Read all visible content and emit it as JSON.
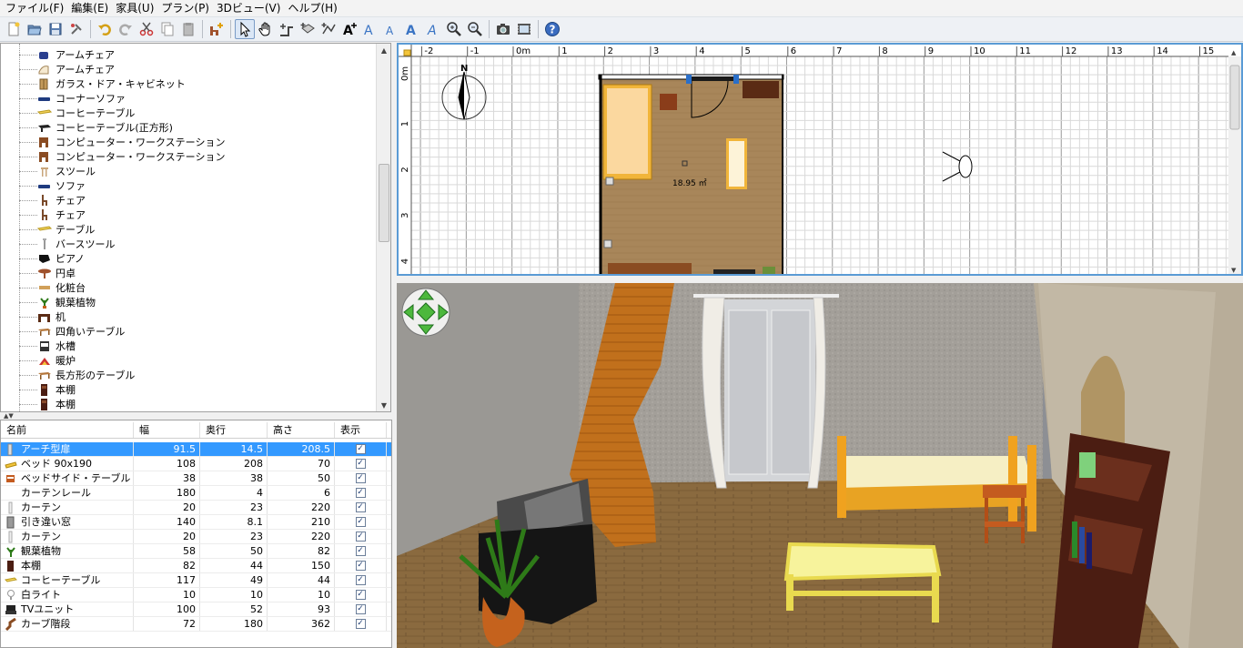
{
  "menubar": {
    "items": [
      "ファイル(F)",
      "編集(E)",
      "家具(U)",
      "プラン(P)",
      "3Dビュー(V)",
      "ヘルプ(H)"
    ]
  },
  "toolbar": {
    "buttons": [
      "new-file-icon",
      "open-file-icon",
      "save-file-icon",
      "cut-icon",
      "sep",
      "undo-icon",
      "redo-icon",
      "scissors-icon",
      "copy-icon",
      "paste-icon",
      "sep",
      "add-furniture-icon",
      "sep",
      "select-arrow-icon",
      "pan-hand-icon",
      "create-walls-icon",
      "create-rooms-icon",
      "create-dimensions-icon",
      "add-text-icon",
      "text-style-a-icon",
      "text-style-b-icon",
      "text-bold-icon",
      "text-italic-icon",
      "zoom-in-icon",
      "zoom-out-icon",
      "sep",
      "create-photo-icon",
      "create-video-icon",
      "sep",
      "help-icon"
    ]
  },
  "catalog": {
    "items": [
      {
        "label": "アームチェア",
        "icon": "armchair-blue"
      },
      {
        "label": "アームチェア",
        "icon": "armchair-white"
      },
      {
        "label": "ガラス・ドア・キャビネット",
        "icon": "cabinet"
      },
      {
        "label": "コーナーソファ",
        "icon": "sofa-blue"
      },
      {
        "label": "コーヒーテーブル",
        "icon": "table-yellow"
      },
      {
        "label": "コーヒーテーブル(正方形)",
        "icon": "table-black"
      },
      {
        "label": "コンピューター・ワークステーション",
        "icon": "workstation"
      },
      {
        "label": "コンピューター・ワークステーション",
        "icon": "workstation"
      },
      {
        "label": "スツール",
        "icon": "stool"
      },
      {
        "label": "ソファ",
        "icon": "sofa-blue"
      },
      {
        "label": "チェア",
        "icon": "chair"
      },
      {
        "label": "チェア",
        "icon": "chair"
      },
      {
        "label": "テーブル",
        "icon": "table-yellow"
      },
      {
        "label": "バースツール",
        "icon": "barstool"
      },
      {
        "label": "ピアノ",
        "icon": "piano"
      },
      {
        "label": "円卓",
        "icon": "round-table"
      },
      {
        "label": "化粧台",
        "icon": "dresser"
      },
      {
        "label": "観葉植物",
        "icon": "plant"
      },
      {
        "label": "机",
        "icon": "desk"
      },
      {
        "label": "四角いテーブル",
        "icon": "table-brown"
      },
      {
        "label": "水槽",
        "icon": "aquarium"
      },
      {
        "label": "暖炉",
        "icon": "fireplace"
      },
      {
        "label": "長方形のテーブル",
        "icon": "table-brown"
      },
      {
        "label": "本棚",
        "icon": "bookshelf"
      },
      {
        "label": "本棚",
        "icon": "bookshelf"
      }
    ]
  },
  "furniture_table": {
    "headers": [
      "名前",
      "幅",
      "奥行",
      "高さ",
      "表示"
    ],
    "rows": [
      {
        "name": "アーチ型扉",
        "width": "91.5",
        "depth": "14.5",
        "height": "208.5",
        "visible": true,
        "selected": true,
        "icon": "door"
      },
      {
        "name": "ベッド 90x190",
        "width": "108",
        "depth": "208",
        "height": "70",
        "visible": true,
        "icon": "bed"
      },
      {
        "name": "ベッドサイド・テーブル",
        "width": "38",
        "depth": "38",
        "height": "50",
        "visible": true,
        "icon": "bedside"
      },
      {
        "name": "カーテンレール",
        "width": "180",
        "depth": "4",
        "height": "6",
        "visible": true,
        "icon": "none"
      },
      {
        "name": "カーテン",
        "width": "20",
        "depth": "23",
        "height": "220",
        "visible": true,
        "icon": "curtain"
      },
      {
        "name": "引き違い窓",
        "width": "140",
        "depth": "8.1",
        "height": "210",
        "visible": true,
        "icon": "window"
      },
      {
        "name": "カーテン",
        "width": "20",
        "depth": "23",
        "height": "220",
        "visible": true,
        "icon": "curtain"
      },
      {
        "name": "観葉植物",
        "width": "58",
        "depth": "50",
        "height": "82",
        "visible": true,
        "icon": "plant"
      },
      {
        "name": "本棚",
        "width": "82",
        "depth": "44",
        "height": "150",
        "visible": true,
        "icon": "bookshelf"
      },
      {
        "name": "コーヒーテーブル",
        "width": "117",
        "depth": "49",
        "height": "44",
        "visible": true,
        "icon": "table-yellow"
      },
      {
        "name": "白ライト",
        "width": "10",
        "depth": "10",
        "height": "10",
        "visible": true,
        "icon": "light"
      },
      {
        "name": "TVユニット",
        "width": "100",
        "depth": "52",
        "height": "93",
        "visible": true,
        "icon": "tv"
      },
      {
        "name": "カーブ階段",
        "width": "72",
        "depth": "180",
        "height": "362",
        "visible": true,
        "icon": "stairs"
      }
    ]
  },
  "plan": {
    "ruler_x": [
      "-2",
      "-1",
      "0m",
      "1",
      "2",
      "3",
      "4",
      "5",
      "6",
      "7",
      "8",
      "9",
      "10",
      "11",
      "12",
      "13",
      "14",
      "15"
    ],
    "ruler_y": [
      "0m",
      "1",
      "2",
      "3",
      "4"
    ],
    "room_area": "18.95 ㎡",
    "compass_label": "N"
  },
  "colors": {
    "selection": "#3399ff",
    "plan_border": "#5a9bd5",
    "floor": "#9a7a4f",
    "wall": "#b8ae9e"
  }
}
